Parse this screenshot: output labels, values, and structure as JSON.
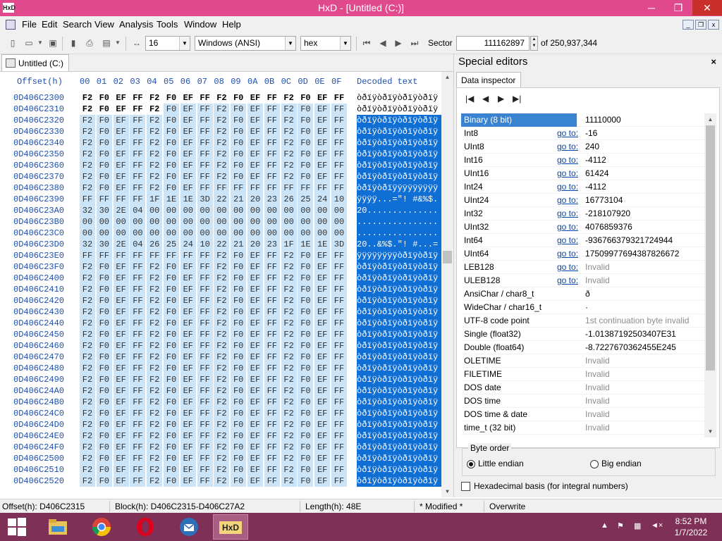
{
  "window": {
    "title": "HxD - [Untitled (C:)]",
    "app_icon": "hxd-icon",
    "minimize": "─",
    "maximize": "❐",
    "close": "✕"
  },
  "menu": {
    "items": [
      "File",
      "Edit",
      "Search",
      "View",
      "Analysis",
      "Tools",
      "Window",
      "Help"
    ]
  },
  "mdi_controls": {
    "minimize": "_",
    "restore": "❐",
    "close": "x"
  },
  "toolbar": {
    "bytes_per_row": "16",
    "charset": "Windows (ANSI)",
    "base": "hex",
    "sector_label": "Sector",
    "sector_value": "111162897",
    "sector_total": "of 250,937,344"
  },
  "document_tab": {
    "label": "Untitled (C:)"
  },
  "hex_view": {
    "offset_header": "Offset(h)",
    "column_headers": [
      "00",
      "01",
      "02",
      "03",
      "04",
      "05",
      "06",
      "07",
      "08",
      "09",
      "0A",
      "0B",
      "0C",
      "0D",
      "0E",
      "0F"
    ],
    "decoded_header": "Decoded text",
    "rows": [
      {
        "offset": "0D406C2300",
        "bytes": [
          "F2",
          "F0",
          "EF",
          "FF",
          "F2",
          "F0",
          "EF",
          "FF",
          "F2",
          "F0",
          "EF",
          "FF",
          "F2",
          "F0",
          "EF",
          "FF"
        ],
        "text": "òðïÿòðïÿòðïÿòðïÿ"
      },
      {
        "offset": "0D406C2310",
        "bytes": [
          "F2",
          "F0",
          "EF",
          "FF",
          "F2",
          "F0",
          "EF",
          "FF",
          "F2",
          "F0",
          "EF",
          "FF",
          "F2",
          "F0",
          "EF",
          "FF"
        ],
        "text": "òðïÿòðïÿòðïÿòðïÿ"
      },
      {
        "offset": "0D406C2320",
        "bytes": [
          "F2",
          "F0",
          "EF",
          "FF",
          "F2",
          "F0",
          "EF",
          "FF",
          "F2",
          "F0",
          "EF",
          "FF",
          "F2",
          "F0",
          "EF",
          "FF"
        ],
        "text": "òðïÿòðïÿòðïÿòðïÿ"
      },
      {
        "offset": "0D406C2330",
        "bytes": [
          "F2",
          "F0",
          "EF",
          "FF",
          "F2",
          "F0",
          "EF",
          "FF",
          "F2",
          "F0",
          "EF",
          "FF",
          "F2",
          "F0",
          "EF",
          "FF"
        ],
        "text": "òðïÿòðïÿòðïÿòðïÿ"
      },
      {
        "offset": "0D406C2340",
        "bytes": [
          "F2",
          "F0",
          "EF",
          "FF",
          "F2",
          "F0",
          "EF",
          "FF",
          "F2",
          "F0",
          "EF",
          "FF",
          "F2",
          "F0",
          "EF",
          "FF"
        ],
        "text": "òðïÿòðïÿòðïÿòðïÿ"
      },
      {
        "offset": "0D406C2350",
        "bytes": [
          "F2",
          "F0",
          "EF",
          "FF",
          "F2",
          "F0",
          "EF",
          "FF",
          "F2",
          "F0",
          "EF",
          "FF",
          "F2",
          "F0",
          "EF",
          "FF"
        ],
        "text": "òðïÿòðïÿòðïÿòðïÿ"
      },
      {
        "offset": "0D406C2360",
        "bytes": [
          "F2",
          "F0",
          "EF",
          "FF",
          "F2",
          "F0",
          "EF",
          "FF",
          "F2",
          "F0",
          "EF",
          "FF",
          "F2",
          "F0",
          "EF",
          "FF"
        ],
        "text": "òðïÿòðïÿòðïÿòðïÿ"
      },
      {
        "offset": "0D406C2370",
        "bytes": [
          "F2",
          "F0",
          "EF",
          "FF",
          "F2",
          "F0",
          "EF",
          "FF",
          "F2",
          "F0",
          "EF",
          "FF",
          "F2",
          "F0",
          "EF",
          "FF"
        ],
        "text": "òðïÿòðïÿòðïÿòðïÿ"
      },
      {
        "offset": "0D406C2380",
        "bytes": [
          "F2",
          "F0",
          "EF",
          "FF",
          "F2",
          "F0",
          "EF",
          "FF",
          "FF",
          "FF",
          "FF",
          "FF",
          "FF",
          "FF",
          "FF",
          "FF"
        ],
        "text": "òðïÿòðïÿÿÿÿÿÿÿÿÿ"
      },
      {
        "offset": "0D406C2390",
        "bytes": [
          "FF",
          "FF",
          "FF",
          "FF",
          "1F",
          "1E",
          "1E",
          "3D",
          "22",
          "21",
          "20",
          "23",
          "26",
          "25",
          "24",
          "10"
        ],
        "text": "ÿÿÿÿ...=\"! #&%$."
      },
      {
        "offset": "0D406C23A0",
        "bytes": [
          "32",
          "30",
          "2E",
          "04",
          "00",
          "00",
          "00",
          "00",
          "00",
          "00",
          "00",
          "00",
          "00",
          "00",
          "00",
          "00"
        ],
        "text": "20.............."
      },
      {
        "offset": "0D406C23B0",
        "bytes": [
          "00",
          "00",
          "00",
          "00",
          "00",
          "00",
          "00",
          "00",
          "00",
          "00",
          "00",
          "00",
          "00",
          "00",
          "00",
          "00"
        ],
        "text": "................"
      },
      {
        "offset": "0D406C23C0",
        "bytes": [
          "00",
          "00",
          "00",
          "00",
          "00",
          "00",
          "00",
          "00",
          "00",
          "00",
          "00",
          "00",
          "00",
          "00",
          "00",
          "00"
        ],
        "text": "................"
      },
      {
        "offset": "0D406C23D0",
        "bytes": [
          "32",
          "30",
          "2E",
          "04",
          "26",
          "25",
          "24",
          "10",
          "22",
          "21",
          "20",
          "23",
          "1F",
          "1E",
          "1E",
          "3D"
        ],
        "text": "20..&%$.\"! #...="
      },
      {
        "offset": "0D406C23E0",
        "bytes": [
          "FF",
          "FF",
          "FF",
          "FF",
          "FF",
          "FF",
          "FF",
          "FF",
          "F2",
          "F0",
          "EF",
          "FF",
          "F2",
          "F0",
          "EF",
          "FF"
        ],
        "text": "ÿÿÿÿÿÿÿÿòðïÿòðïÿ"
      },
      {
        "offset": "0D406C23F0",
        "bytes": [
          "F2",
          "F0",
          "EF",
          "FF",
          "F2",
          "F0",
          "EF",
          "FF",
          "F2",
          "F0",
          "EF",
          "FF",
          "F2",
          "F0",
          "EF",
          "FF"
        ],
        "text": "òðïÿòðïÿòðïÿòðïÿ"
      },
      {
        "offset": "0D406C2400",
        "bytes": [
          "F2",
          "F0",
          "EF",
          "FF",
          "F2",
          "F0",
          "EF",
          "FF",
          "F2",
          "F0",
          "EF",
          "FF",
          "F2",
          "F0",
          "EF",
          "FF"
        ],
        "text": "òðïÿòðïÿòðïÿòðïÿ"
      },
      {
        "offset": "0D406C2410",
        "bytes": [
          "F2",
          "F0",
          "EF",
          "FF",
          "F2",
          "F0",
          "EF",
          "FF",
          "F2",
          "F0",
          "EF",
          "FF",
          "F2",
          "F0",
          "EF",
          "FF"
        ],
        "text": "òðïÿòðïÿòðïÿòðïÿ"
      },
      {
        "offset": "0D406C2420",
        "bytes": [
          "F2",
          "F0",
          "EF",
          "FF",
          "F2",
          "F0",
          "EF",
          "FF",
          "F2",
          "F0",
          "EF",
          "FF",
          "F2",
          "F0",
          "EF",
          "FF"
        ],
        "text": "òðïÿòðïÿòðïÿòðïÿ"
      },
      {
        "offset": "0D406C2430",
        "bytes": [
          "F2",
          "F0",
          "EF",
          "FF",
          "F2",
          "F0",
          "EF",
          "FF",
          "F2",
          "F0",
          "EF",
          "FF",
          "F2",
          "F0",
          "EF",
          "FF"
        ],
        "text": "òðïÿòðïÿòðïÿòðïÿ"
      },
      {
        "offset": "0D406C2440",
        "bytes": [
          "F2",
          "F0",
          "EF",
          "FF",
          "F2",
          "F0",
          "EF",
          "FF",
          "F2",
          "F0",
          "EF",
          "FF",
          "F2",
          "F0",
          "EF",
          "FF"
        ],
        "text": "òðïÿòðïÿòðïÿòðïÿ"
      },
      {
        "offset": "0D406C2450",
        "bytes": [
          "F2",
          "F0",
          "EF",
          "FF",
          "F2",
          "F0",
          "EF",
          "FF",
          "F2",
          "F0",
          "EF",
          "FF",
          "F2",
          "F0",
          "EF",
          "FF"
        ],
        "text": "òðïÿòðïÿòðïÿòðïÿ"
      },
      {
        "offset": "0D406C2460",
        "bytes": [
          "F2",
          "F0",
          "EF",
          "FF",
          "F2",
          "F0",
          "EF",
          "FF",
          "F2",
          "F0",
          "EF",
          "FF",
          "F2",
          "F0",
          "EF",
          "FF"
        ],
        "text": "òðïÿòðïÿòðïÿòðïÿ"
      },
      {
        "offset": "0D406C2470",
        "bytes": [
          "F2",
          "F0",
          "EF",
          "FF",
          "F2",
          "F0",
          "EF",
          "FF",
          "F2",
          "F0",
          "EF",
          "FF",
          "F2",
          "F0",
          "EF",
          "FF"
        ],
        "text": "òðïÿòðïÿòðïÿòðïÿ"
      },
      {
        "offset": "0D406C2480",
        "bytes": [
          "F2",
          "F0",
          "EF",
          "FF",
          "F2",
          "F0",
          "EF",
          "FF",
          "F2",
          "F0",
          "EF",
          "FF",
          "F2",
          "F0",
          "EF",
          "FF"
        ],
        "text": "òðïÿòðïÿòðïÿòðïÿ"
      },
      {
        "offset": "0D406C2490",
        "bytes": [
          "F2",
          "F0",
          "EF",
          "FF",
          "F2",
          "F0",
          "EF",
          "FF",
          "F2",
          "F0",
          "EF",
          "FF",
          "F2",
          "F0",
          "EF",
          "FF"
        ],
        "text": "òðïÿòðïÿòðïÿòðïÿ"
      },
      {
        "offset": "0D406C24A0",
        "bytes": [
          "F2",
          "F0",
          "EF",
          "FF",
          "F2",
          "F0",
          "EF",
          "FF",
          "F2",
          "F0",
          "EF",
          "FF",
          "F2",
          "F0",
          "EF",
          "FF"
        ],
        "text": "òðïÿòðïÿòðïÿòðïÿ"
      },
      {
        "offset": "0D406C24B0",
        "bytes": [
          "F2",
          "F0",
          "EF",
          "FF",
          "F2",
          "F0",
          "EF",
          "FF",
          "F2",
          "F0",
          "EF",
          "FF",
          "F2",
          "F0",
          "EF",
          "FF"
        ],
        "text": "òðïÿòðïÿòðïÿòðïÿ"
      },
      {
        "offset": "0D406C24C0",
        "bytes": [
          "F2",
          "F0",
          "EF",
          "FF",
          "F2",
          "F0",
          "EF",
          "FF",
          "F2",
          "F0",
          "EF",
          "FF",
          "F2",
          "F0",
          "EF",
          "FF"
        ],
        "text": "òðïÿòðïÿòðïÿòðïÿ"
      },
      {
        "offset": "0D406C24D0",
        "bytes": [
          "F2",
          "F0",
          "EF",
          "FF",
          "F2",
          "F0",
          "EF",
          "FF",
          "F2",
          "F0",
          "EF",
          "FF",
          "F2",
          "F0",
          "EF",
          "FF"
        ],
        "text": "òðïÿòðïÿòðïÿòðïÿ"
      },
      {
        "offset": "0D406C24E0",
        "bytes": [
          "F2",
          "F0",
          "EF",
          "FF",
          "F2",
          "F0",
          "EF",
          "FF",
          "F2",
          "F0",
          "EF",
          "FF",
          "F2",
          "F0",
          "EF",
          "FF"
        ],
        "text": "òðïÿòðïÿòðïÿòðïÿ"
      },
      {
        "offset": "0D406C24F0",
        "bytes": [
          "F2",
          "F0",
          "EF",
          "FF",
          "F2",
          "F0",
          "EF",
          "FF",
          "F2",
          "F0",
          "EF",
          "FF",
          "F2",
          "F0",
          "EF",
          "FF"
        ],
        "text": "òðïÿòðïÿòðïÿòðïÿ"
      },
      {
        "offset": "0D406C2500",
        "bytes": [
          "F2",
          "F0",
          "EF",
          "FF",
          "F2",
          "F0",
          "EF",
          "FF",
          "F2",
          "F0",
          "EF",
          "FF",
          "F2",
          "F0",
          "EF",
          "FF"
        ],
        "text": "òðïÿòðïÿòðïÿòðïÿ"
      },
      {
        "offset": "0D406C2510",
        "bytes": [
          "F2",
          "F0",
          "EF",
          "FF",
          "F2",
          "F0",
          "EF",
          "FF",
          "F2",
          "F0",
          "EF",
          "FF",
          "F2",
          "F0",
          "EF",
          "FF"
        ],
        "text": "òðïÿòðïÿòðïÿòðïÿ"
      },
      {
        "offset": "0D406C2520",
        "bytes": [
          "F2",
          "F0",
          "EF",
          "FF",
          "F2",
          "F0",
          "EF",
          "FF",
          "F2",
          "F0",
          "EF",
          "FF",
          "F2",
          "F0",
          "EF",
          "FF"
        ],
        "text": "òðïÿòðïÿòðïÿòðïÿ"
      }
    ]
  },
  "special_editors": {
    "title": "Special editors",
    "close": "×",
    "tab": "Data inspector",
    "nav": [
      "|◀",
      "◀",
      "▶",
      "▶|"
    ],
    "rows": [
      {
        "name": "Binary (8 bit)",
        "goto": "",
        "value": "11110000",
        "invalid": false
      },
      {
        "name": "Int8",
        "goto": "go to:",
        "value": "-16",
        "invalid": false
      },
      {
        "name": "UInt8",
        "goto": "go to:",
        "value": "240",
        "invalid": false
      },
      {
        "name": "Int16",
        "goto": "go to:",
        "value": "-4112",
        "invalid": false
      },
      {
        "name": "UInt16",
        "goto": "go to:",
        "value": "61424",
        "invalid": false
      },
      {
        "name": "Int24",
        "goto": "go to:",
        "value": "-4112",
        "invalid": false
      },
      {
        "name": "UInt24",
        "goto": "go to:",
        "value": "16773104",
        "invalid": false
      },
      {
        "name": "Int32",
        "goto": "go to:",
        "value": "-218107920",
        "invalid": false
      },
      {
        "name": "UInt32",
        "goto": "go to:",
        "value": "4076859376",
        "invalid": false
      },
      {
        "name": "Int64",
        "goto": "go to:",
        "value": "-936766379321724944",
        "invalid": false
      },
      {
        "name": "UInt64",
        "goto": "go to:",
        "value": "17509977694387826672",
        "invalid": false
      },
      {
        "name": "LEB128",
        "goto": "go to:",
        "value": "Invalid",
        "invalid": true
      },
      {
        "name": "ULEB128",
        "goto": "go to:",
        "value": "Invalid",
        "invalid": true
      },
      {
        "name": "AnsiChar / char8_t",
        "goto": "",
        "value": "ð",
        "invalid": false
      },
      {
        "name": "WideChar / char16_t",
        "goto": "",
        "value": "·",
        "invalid": false
      },
      {
        "name": "UTF-8 code point",
        "goto": "",
        "value": "1st continuation byte invalid",
        "invalid": true
      },
      {
        "name": "Single (float32)",
        "goto": "",
        "value": "-1.01387192503407E31",
        "invalid": false
      },
      {
        "name": "Double (float64)",
        "goto": "",
        "value": "-8.7227670362455E245",
        "invalid": false
      },
      {
        "name": "OLETIME",
        "goto": "",
        "value": "Invalid",
        "invalid": true
      },
      {
        "name": "FILETIME",
        "goto": "",
        "value": "Invalid",
        "invalid": true
      },
      {
        "name": "DOS date",
        "goto": "",
        "value": "Invalid",
        "invalid": true
      },
      {
        "name": "DOS time",
        "goto": "",
        "value": "Invalid",
        "invalid": true
      },
      {
        "name": "DOS time & date",
        "goto": "",
        "value": "Invalid",
        "invalid": true
      },
      {
        "name": "time_t (32 bit)",
        "goto": "",
        "value": "Invalid",
        "invalid": true
      },
      {
        "name": "time_t (64 bit)",
        "goto": "",
        "value": "Invalid",
        "invalid": true
      }
    ],
    "byte_order_label": "Byte order",
    "little_endian": "Little endian",
    "big_endian": "Big endian",
    "hex_basis": "Hexadecimal basis (for integral numbers)"
  },
  "status_bar": {
    "offset": "Offset(h): D406C2315",
    "block": "Block(h): D406C2315-D406C27A2",
    "length": "Length(h): 48E",
    "modified": "* Modified *",
    "mode": "Overwrite"
  },
  "taskbar": {
    "time": "8:52 PM",
    "date": "1/7/2022"
  }
}
